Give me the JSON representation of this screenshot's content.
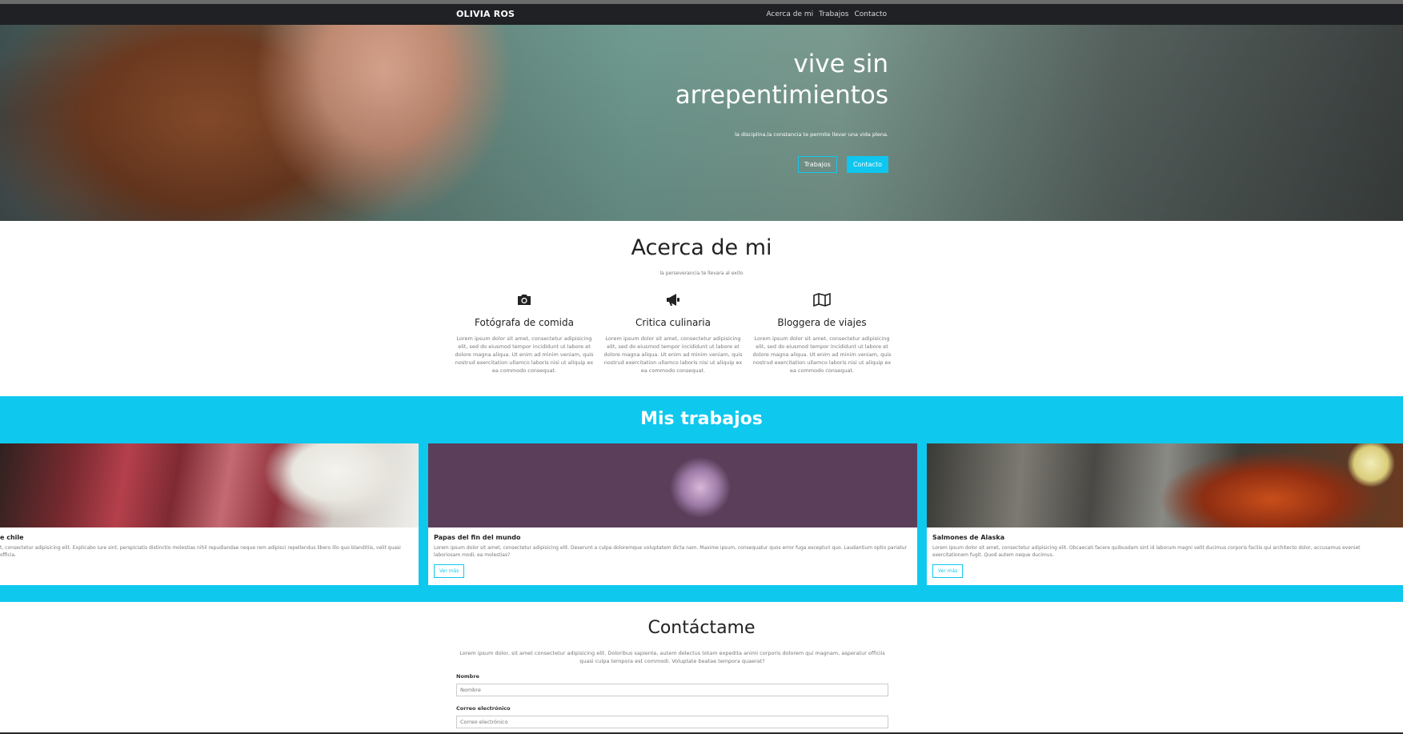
{
  "nav": {
    "brand": "OLIVIA ROS",
    "links": [
      "Acerca de mi",
      "Trabajos",
      "Contacto"
    ]
  },
  "hero": {
    "title": "vive sin arrepentimientos",
    "subtitle": "la disciplina,la constancia te permite llevar una vida plena.",
    "btn_works": "Trabajos",
    "btn_contact": "Contacto"
  },
  "about": {
    "title": "Acerca de mi",
    "subtitle": "la perseverancia te llevara al exito",
    "features": [
      {
        "icon": "camera-icon",
        "title": "Fotógrafa de comida",
        "text": "Lorem ipsum dolor sit amet, consectetur adipisicing elit, sed do eiusmod tempor incididunt ut labore et dolore magna aliqua. Ut enim ad minim veniam, quis nostrud exercitation ullamco laboris nisi ut aliquip ex ea commodo consequat."
      },
      {
        "icon": "megaphone-icon",
        "title": "Critica culinaria",
        "text": "Lorem ipsum dolor sit amet, consectetur adipisicing elit, sed do eiusmod tempor incididunt ut labore et dolore magna aliqua. Ut enim ad minim veniam, quis nostrud exercitation ullamco laboris nisi ut aliquip ex ea commodo consequat."
      },
      {
        "icon": "map-icon",
        "title": "Bloggera de viajes",
        "text": "Lorem ipsum dolor sit amet, consectetur adipisicing elit, sed do eiusmod tempor incididunt ut labore et dolore magna aliqua. Ut enim ad minim veniam, quis nostrud exercitation ullamco laboris nisi ut aliquip ex ea commodo consequat."
      }
    ]
  },
  "works": {
    "title": "Mis trabajos",
    "cards": [
      {
        "title": "e chile",
        "text": "t, consectetur adipisicing elit. Explicabo iure sint, perspiciatis distinctio molestias nihil repudiandae neque rem adipisci repellendus libero illo quo blanditiis, velit quasi officia.",
        "button": ""
      },
      {
        "title": "Papas del fin del mundo",
        "text": "Lorem ipsum dolor sit amet, consectetur adipisicing elit. Deserunt a culpa doloremque voluptatem dicta nam. Maxime ipsum, consequatur quos error fuga excepturi quo. Laudantium optio pariatur laboriosam modi, ea molestias?",
        "button": "Ver más"
      },
      {
        "title": "Salmones de Alaska",
        "text": "Lorem ipsum dolor sit amet, consectetur adipisicing elit. Obcaecati facere quibusdam sint id laborum magni velit ducimus corporis facilis qui architecto dolor, accusamus eveniet exercitationem fugit. Quod autem neque ducimus.",
        "button": "Ver más"
      }
    ]
  },
  "contact": {
    "title": "Contáctame",
    "text": "Lorem ipsum dolor, sit amet consectetur adipisicing elit. Doloribus sapiente, autem delectus totam expedita animi corporis dolorem qui magnam, asperatur officiis quasi culpa tempora est commodi. Voluptate beatae tempora quaerat?",
    "name_label": "Nombre",
    "name_placeholder": "Nombre",
    "email_label": "Correo electrónico",
    "email_placeholder": "Correo electrónico"
  },
  "colors": {
    "accent": "#0fc8ee",
    "navbar": "#1f2125"
  }
}
